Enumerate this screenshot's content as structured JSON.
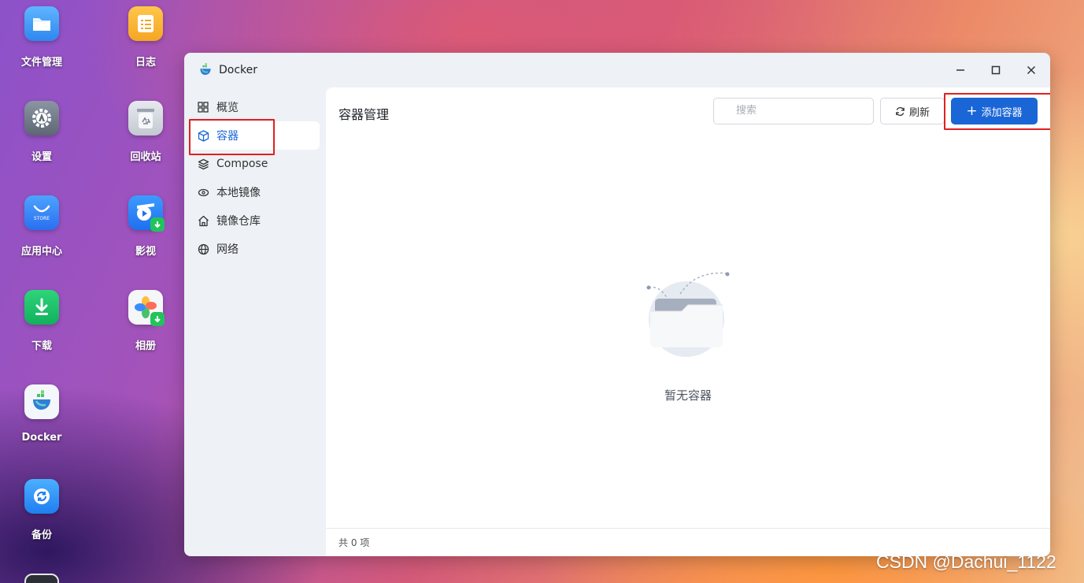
{
  "desktop": {
    "icons": [
      {
        "label": "文件管理",
        "icon": "folder-icon"
      },
      {
        "label": "日志",
        "icon": "log-icon"
      },
      {
        "label": "设置",
        "icon": "settings-icon"
      },
      {
        "label": "回收站",
        "icon": "recycle-bin-icon"
      },
      {
        "label": "应用中心",
        "icon": "store-icon",
        "badge": "STORE"
      },
      {
        "label": "影视",
        "icon": "video-icon"
      },
      {
        "label": "下载",
        "icon": "download-icon"
      },
      {
        "label": "相册",
        "icon": "photos-icon"
      },
      {
        "label": "Docker",
        "icon": "docker-icon"
      },
      {
        "label": "备份",
        "icon": "backup-icon"
      }
    ]
  },
  "window": {
    "title": "Docker",
    "controls": [
      "minimize-icon",
      "maximize-icon",
      "close-icon"
    ]
  },
  "sidebar": {
    "items": [
      {
        "label": "概览",
        "icon": "grid-icon",
        "active": false
      },
      {
        "label": "容器",
        "icon": "cube-icon",
        "active": true
      },
      {
        "label": "Compose",
        "icon": "layers-icon",
        "active": false
      },
      {
        "label": "本地镜像",
        "icon": "disk-icon",
        "active": false
      },
      {
        "label": "镜像仓库",
        "icon": "house-icon",
        "active": false
      },
      {
        "label": "网络",
        "icon": "globe-icon",
        "active": false
      }
    ]
  },
  "main": {
    "title": "容器管理",
    "search_placeholder": "搜索",
    "refresh_label": "刷新",
    "add_label": "添加容器",
    "empty_text": "暂无容器",
    "footer_text": "共 0 项"
  },
  "colors": {
    "accent": "#1a66d6",
    "highlight_box": "#e02020"
  },
  "watermark": "CSDN @Dachui_1122"
}
